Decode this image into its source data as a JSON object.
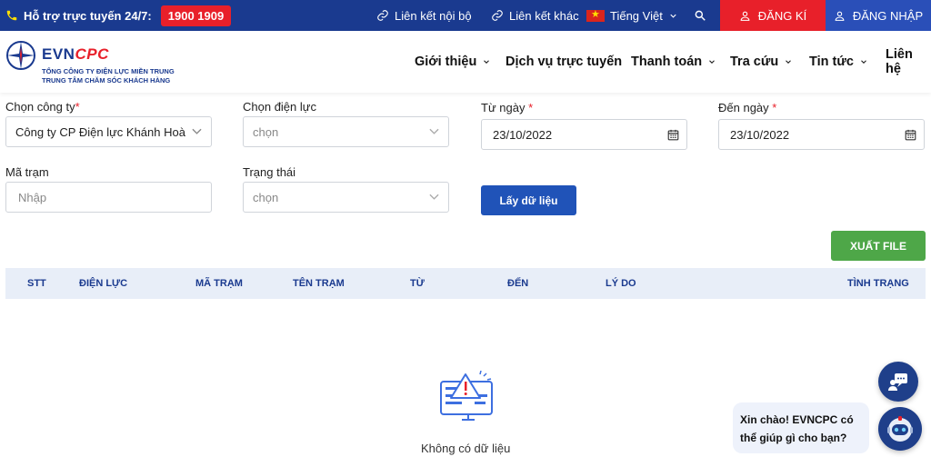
{
  "topbar": {
    "hotline_label": "Hỗ trợ trực tuyến 24/7:",
    "hotline_number": "1900 1909",
    "internal_links": "Liên kết nội bộ",
    "external_links": "Liên kết khác",
    "language": "Tiếng Việt",
    "register": "ĐĂNG KÍ",
    "login": "ĐĂNG NHẬP"
  },
  "header": {
    "logo_evn": "EVN",
    "logo_cpc": "CPC",
    "logo_line1": "TỔNG CÔNG TY ĐIỆN LỰC MIỀN TRUNG",
    "logo_line2": "TRUNG TÂM CHĂM SÓC KHÁCH HÀNG",
    "nav": {
      "intro": "Giới thiệu",
      "online_services": "Dịch vụ trực tuyến",
      "payment": "Thanh toán",
      "lookup": "Tra cứu",
      "news": "Tin tức",
      "contact": "Liên hệ"
    }
  },
  "form": {
    "company_label": "Chọn công ty",
    "company_value": "Công ty CP Điện lực Khánh Hoà",
    "power_label": "Chọn điện lực",
    "power_placeholder": "chọn",
    "from_label": "Từ ngày",
    "from_value": "23/10/2022",
    "to_label": "Đến ngày",
    "to_value": "23/10/2022",
    "station_label": "Mã trạm",
    "station_placeholder": "Nhập",
    "status_label": "Trạng thái",
    "status_placeholder": "chọn",
    "required_mark": "*",
    "fetch_button": "Lấy dữ liệu",
    "export_button": "XUẤT FILE"
  },
  "table": {
    "columns": [
      "STT",
      "ĐIỆN LỰC",
      "MÃ TRẠM",
      "TÊN TRẠM",
      "TỪ",
      "ĐẾN",
      "LÝ DO",
      "TÌNH TRẠNG"
    ],
    "empty_text": "Không có dữ liệu"
  },
  "chat": {
    "greeting": "Xin chào! EVNCPC có thể giúp gì cho bạn?"
  },
  "colors": {
    "brand_blue": "#1a3a8f",
    "accent_red": "#e8202a",
    "primary_button": "#2053b8",
    "export_green": "#4ea748"
  }
}
